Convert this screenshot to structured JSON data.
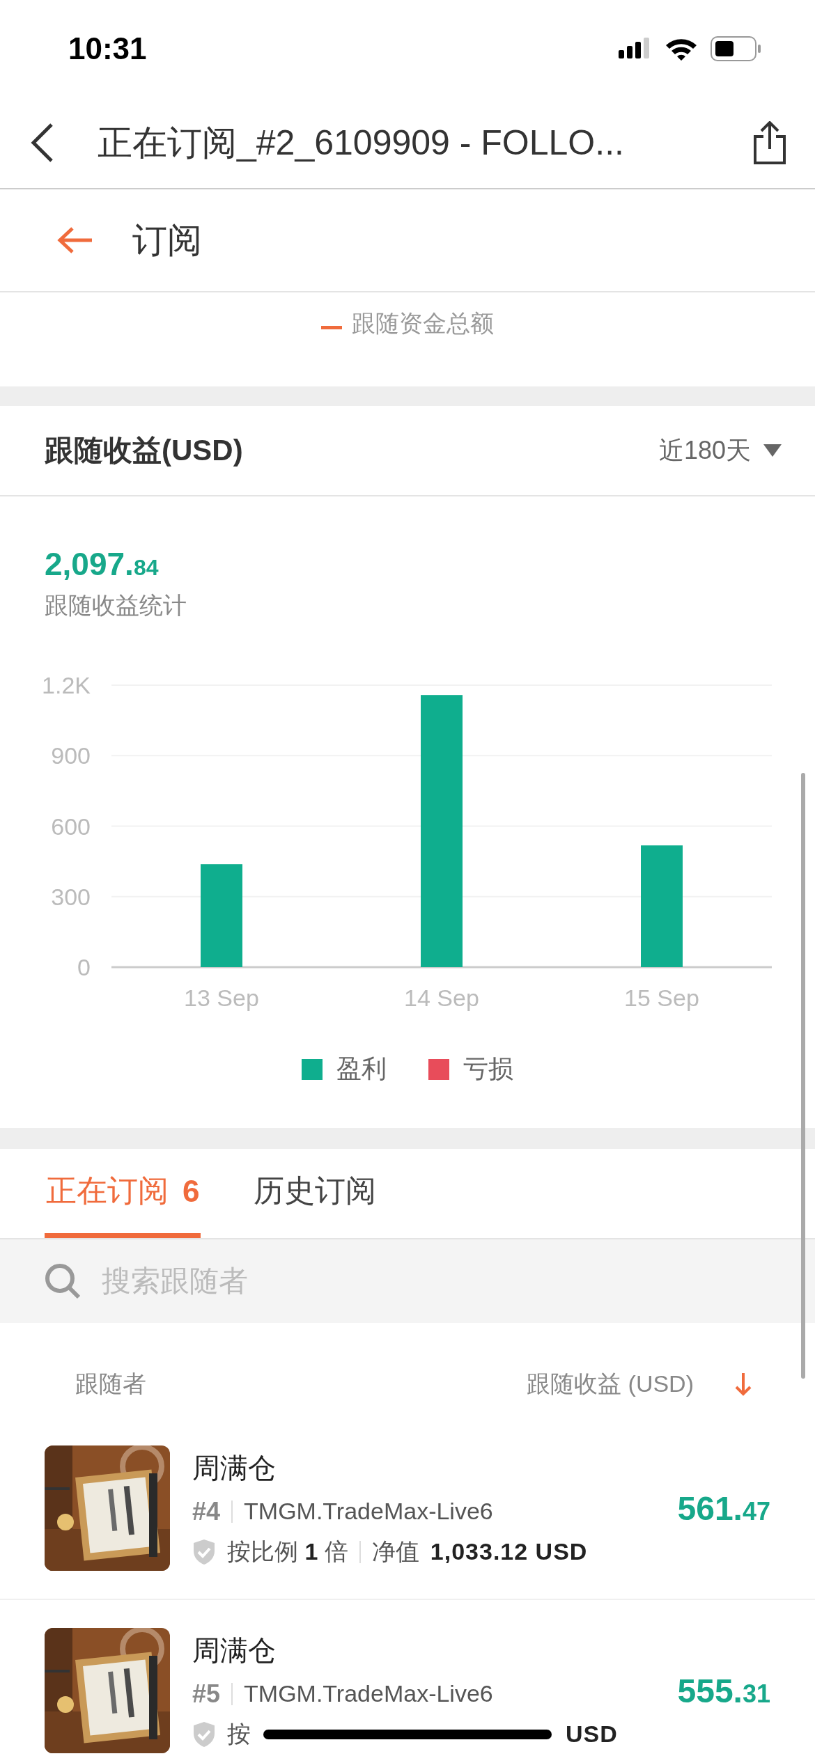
{
  "status_bar": {
    "time": "10:31"
  },
  "nav": {
    "title": "正在订阅_#2_6109909 - FOLLO..."
  },
  "subheader": {
    "title": "订阅"
  },
  "fund_legend": {
    "label": "跟随资金总额"
  },
  "earnings": {
    "title": "跟随收益(USD)",
    "period": "近180天",
    "total_main": "2,097.",
    "total_fraction": "84",
    "total_label": "跟随收益统计",
    "chart_data": {
      "type": "bar",
      "categories": [
        "13 Sep",
        "14 Sep",
        "15 Sep"
      ],
      "series": [
        {
          "name": "盈利",
          "color": "#0fae8e",
          "values": [
            438,
            1158,
            518
          ]
        },
        {
          "name": "亏损",
          "color": "#e84c5a",
          "values": [
            null,
            null,
            null
          ]
        }
      ],
      "grid": true,
      "ylim": [
        0,
        1200
      ],
      "yticks": [
        0,
        300,
        600,
        900,
        {
          "value": 1200,
          "label": "1.2K"
        }
      ]
    }
  },
  "tabs": [
    {
      "label": "正在订阅",
      "count": "6",
      "selected": true
    },
    {
      "label": "历史订阅",
      "selected": false
    }
  ],
  "search": {
    "placeholder": "搜索跟随者"
  },
  "columns": {
    "follower": "跟随者",
    "earnings": "跟随收益 (USD)"
  },
  "followers": [
    {
      "name": "周满仓",
      "rank": "#4",
      "server": "TMGM.TradeMax-Live6",
      "ratio": "按比例 **1** 倍",
      "net_label": "净值",
      "net_value": "1,033.12 USD",
      "profit_main": "561.",
      "profit_fraction": "47"
    },
    {
      "name": "周满仓",
      "rank": "#5",
      "server": "TMGM.TradeMax-Live6",
      "ratio": "按",
      "net_value": "USD",
      "profit_main": "555.",
      "profit_fraction": "31"
    }
  ]
}
